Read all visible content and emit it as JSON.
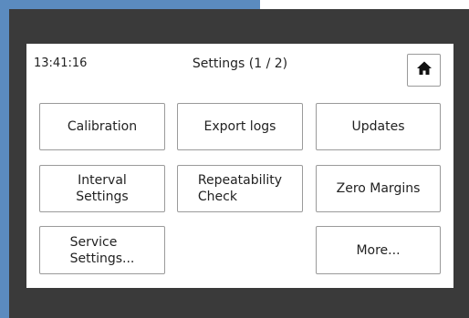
{
  "header": {
    "time": "13:41:16",
    "title": "Settings (1 / 2)",
    "home_icon": "home-icon"
  },
  "buttons": {
    "calibration": "Calibration",
    "export_logs": "Export logs",
    "updates": "Updates",
    "interval_settings": "Interval\nSettings",
    "repeatability_check": "Repeatability\nCheck",
    "zero_margins": "Zero Margins",
    "service_settings": "Service\nSettings...",
    "more": "More..."
  },
  "colors": {
    "background_accent": "#5b8bbf",
    "device_frame": "#3a3a3a",
    "screen": "#ffffff"
  }
}
